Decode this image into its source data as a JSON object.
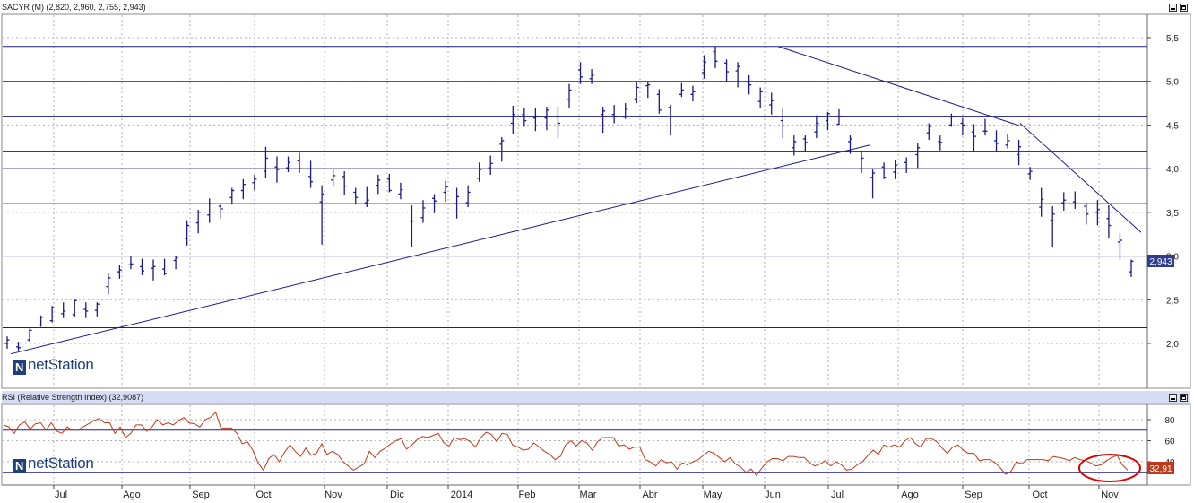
{
  "price_panel": {
    "title": "SACYR (M) (2,820, 2,960, 2,755, 2,943)",
    "last_label": "2,943",
    "logo": "netStation"
  },
  "rsi_panel": {
    "title": "RSI (Relative Strength Index) (32,9087)",
    "last_label": "32,91",
    "logo": "netStation"
  },
  "x_axis_labels": [
    "Jul",
    "Ago",
    "Sep",
    "Oct",
    "Nov",
    "Dic",
    "2014",
    "Feb",
    "Mar",
    "Abr",
    "May",
    "Jun",
    "Jul",
    "Ago",
    "Sep",
    "Oct",
    "Nov"
  ],
  "colors": {
    "price_bar": "#1a1a8c",
    "rsi_line": "#c0391b",
    "trendline": "#1a1a8c",
    "highlight_circle": "#e00000",
    "last_label_bg": "#2e3d8f",
    "rsi_label_bg": "#c0391b"
  },
  "icons": [
    "minimize-icon",
    "maximize-icon",
    "netstation-logo-icon"
  ],
  "chart_data": [
    {
      "type": "bar",
      "subtype": "ohlc",
      "title": "SACYR (M) (2,820, 2,960, 2,755, 2,943)",
      "y_ticks": [
        "2,0",
        "2,5",
        "3,0",
        "3,5",
        "4,0",
        "4,5",
        "5,0",
        "5,5"
      ],
      "ylim": [
        1.6,
        5.7
      ],
      "horizontal_levels": [
        2.18,
        3.0,
        3.6,
        4.0,
        4.2,
        4.6,
        5.0,
        5.4
      ],
      "trendlines": [
        {
          "from": {
            "x": "Jun 2013",
            "y": 1.88
          },
          "to": {
            "x": "Jul 2014",
            "y": 4.27
          }
        },
        {
          "from": {
            "x": "Jun 2014",
            "y": 5.4
          },
          "to": {
            "x": "Sep 2014",
            "y": 4.49
          }
        },
        {
          "from": {
            "x": "Sep 2014",
            "y": 4.52
          },
          "to": {
            "x": "Nov 2014",
            "y": 3.27
          }
        }
      ],
      "series": [
        {
          "values": [
            [
              2.0,
              2.08,
              1.94,
              2.04
            ],
            [
              1.96,
              2.02,
              1.92,
              1.95
            ],
            [
              2.04,
              2.17,
              2.02,
              2.15
            ],
            [
              2.21,
              2.32,
              2.19,
              2.3
            ],
            [
              2.26,
              2.43,
              2.24,
              2.41
            ],
            [
              2.34,
              2.47,
              2.29,
              2.37
            ],
            [
              2.33,
              2.5,
              2.3,
              2.49
            ],
            [
              2.39,
              2.47,
              2.29,
              2.37
            ],
            [
              2.38,
              2.47,
              2.31,
              2.45
            ],
            [
              2.65,
              2.8,
              2.56,
              2.75
            ],
            [
              2.82,
              2.9,
              2.74,
              2.84
            ],
            [
              2.9,
              3.0,
              2.85,
              2.91
            ],
            [
              2.88,
              2.97,
              2.78,
              2.83
            ],
            [
              2.86,
              2.96,
              2.72,
              2.88
            ],
            [
              2.85,
              2.97,
              2.78,
              2.8
            ],
            [
              2.95,
              3.0,
              2.85,
              2.98
            ],
            [
              3.2,
              3.41,
              3.12,
              3.35
            ],
            [
              3.38,
              3.53,
              3.26,
              3.5
            ],
            [
              3.47,
              3.66,
              3.38,
              3.6
            ],
            [
              3.57,
              3.6,
              3.43,
              3.54
            ],
            [
              3.67,
              3.78,
              3.59,
              3.75
            ],
            [
              3.75,
              3.88,
              3.65,
              3.82
            ],
            [
              3.84,
              3.93,
              3.75,
              3.88
            ],
            [
              3.97,
              4.25,
              3.89,
              4.12
            ],
            [
              4.02,
              4.14,
              3.84,
              3.99
            ],
            [
              4.01,
              4.14,
              3.96,
              4.07
            ],
            [
              4.09,
              4.18,
              3.95,
              4.0
            ],
            [
              3.91,
              4.09,
              3.78,
              3.85
            ],
            [
              3.62,
              3.81,
              3.13,
              3.71
            ],
            [
              3.87,
              4.0,
              3.8,
              3.92
            ],
            [
              3.91,
              3.97,
              3.7,
              3.8
            ],
            [
              3.73,
              3.78,
              3.59,
              3.67
            ],
            [
              3.61,
              3.79,
              3.56,
              3.64
            ],
            [
              3.81,
              3.93,
              3.71,
              3.87
            ],
            [
              3.88,
              3.94,
              3.73,
              3.75
            ],
            [
              3.71,
              3.84,
              3.65,
              3.76
            ],
            [
              3.4,
              3.58,
              3.1,
              3.4
            ],
            [
              3.44,
              3.64,
              3.38,
              3.55
            ],
            [
              3.66,
              3.71,
              3.49,
              3.63
            ],
            [
              3.73,
              3.86,
              3.62,
              3.79
            ],
            [
              3.6,
              3.78,
              3.43,
              3.68
            ],
            [
              3.61,
              3.81,
              3.56,
              3.73
            ],
            [
              3.89,
              4.07,
              3.85,
              3.99
            ],
            [
              4.01,
              4.15,
              3.93,
              4.06
            ],
            [
              4.28,
              4.36,
              4.08,
              4.32
            ],
            [
              4.52,
              4.72,
              4.4,
              4.62
            ],
            [
              4.62,
              4.7,
              4.48,
              4.55
            ],
            [
              4.58,
              4.69,
              4.43,
              4.6
            ],
            [
              4.58,
              4.71,
              4.44,
              4.67
            ],
            [
              4.6,
              4.71,
              4.35,
              4.52
            ],
            [
              4.79,
              4.97,
              4.7,
              4.9
            ],
            [
              5.13,
              5.22,
              4.97,
              5.05
            ],
            [
              5.03,
              5.14,
              4.97,
              5.07
            ],
            [
              4.62,
              4.71,
              4.41,
              4.66
            ],
            [
              4.62,
              4.73,
              4.52,
              4.6
            ],
            [
              4.59,
              4.75,
              4.57,
              4.68
            ],
            [
              4.8,
              4.99,
              4.75,
              4.93
            ],
            [
              4.95,
              4.99,
              4.81,
              4.96
            ],
            [
              4.85,
              4.91,
              4.63,
              4.67
            ],
            [
              4.7,
              4.73,
              4.38,
              4.6
            ],
            [
              4.85,
              4.98,
              4.82,
              4.9
            ],
            [
              4.85,
              4.95,
              4.77,
              4.88
            ],
            [
              5.1,
              5.3,
              5.03,
              5.22
            ],
            [
              5.34,
              5.4,
              5.15,
              5.23
            ],
            [
              5.21,
              5.25,
              5.0,
              5.11
            ],
            [
              5.12,
              5.22,
              4.93,
              5.17
            ],
            [
              4.99,
              5.07,
              4.85,
              4.96
            ],
            [
              4.77,
              4.93,
              4.69,
              4.88
            ],
            [
              4.73,
              4.87,
              4.62,
              4.78
            ],
            [
              4.55,
              4.7,
              4.35,
              4.49
            ],
            [
              4.24,
              4.38,
              4.15,
              4.31
            ],
            [
              4.34,
              4.38,
              4.19,
              4.3
            ],
            [
              4.42,
              4.61,
              4.35,
              4.52
            ],
            [
              4.55,
              4.65,
              4.44,
              4.63
            ],
            [
              4.51,
              4.68,
              4.5,
              4.6
            ],
            [
              4.31,
              4.38,
              4.17,
              4.34
            ],
            [
              4.0,
              4.21,
              3.95,
              4.12
            ],
            [
              3.9,
              3.99,
              3.66,
              3.95
            ],
            [
              4.02,
              4.07,
              3.88,
              3.9
            ],
            [
              3.96,
              4.1,
              3.88,
              4.04
            ],
            [
              4.07,
              4.13,
              3.95,
              4.0
            ],
            [
              4.16,
              4.29,
              4.01,
              4.24
            ],
            [
              4.41,
              4.52,
              4.33,
              4.48
            ],
            [
              4.31,
              4.38,
              4.21,
              4.3
            ],
            [
              4.5,
              4.63,
              4.48,
              4.6
            ],
            [
              4.52,
              4.58,
              4.38,
              4.5
            ],
            [
              4.42,
              4.51,
              4.2,
              4.37
            ],
            [
              4.43,
              4.57,
              4.38,
              4.43
            ],
            [
              4.32,
              4.44,
              4.19,
              4.29
            ],
            [
              4.27,
              4.4,
              4.23,
              4.32
            ],
            [
              4.16,
              4.33,
              4.04,
              4.25
            ],
            [
              3.94,
              4.02,
              3.87,
              3.97
            ],
            [
              3.56,
              3.78,
              3.45,
              3.65
            ],
            [
              3.41,
              3.57,
              3.1,
              3.48
            ],
            [
              3.61,
              3.73,
              3.52,
              3.64
            ],
            [
              3.62,
              3.74,
              3.54,
              3.6
            ],
            [
              3.57,
              3.61,
              3.36,
              3.48
            ],
            [
              3.5,
              3.64,
              3.35,
              3.53
            ],
            [
              3.43,
              3.58,
              3.21,
              3.35
            ],
            [
              3.16,
              3.26,
              2.96,
              3.18
            ],
            [
              2.82,
              2.96,
              2.76,
              2.94
            ]
          ]
        }
      ],
      "last_value": 2.943
    },
    {
      "type": "line",
      "title": "RSI (Relative Strength Index) (32,9087)",
      "y_ticks": [
        "40",
        "60",
        "80"
      ],
      "ylim": [
        18,
        92
      ],
      "horizontal_levels": [
        30,
        70
      ],
      "series": [
        {
          "values": [
            75,
            73,
            67,
            75,
            78,
            71,
            76,
            77,
            70,
            77,
            69,
            67,
            73,
            70,
            70,
            73,
            76,
            79,
            81,
            77,
            77,
            67,
            73,
            63,
            67,
            75,
            75,
            69,
            73,
            80,
            75,
            77,
            75,
            79,
            82,
            77,
            76,
            73,
            80,
            82,
            87,
            72,
            72,
            72,
            67,
            57,
            59,
            51,
            39,
            32,
            43,
            47,
            40,
            49,
            56,
            50,
            45,
            53,
            46,
            48,
            57,
            47,
            50,
            47,
            40,
            36,
            32,
            35,
            38,
            50,
            44,
            50,
            53,
            57,
            60,
            62,
            52,
            56,
            61,
            64,
            63,
            65,
            67,
            58,
            55,
            63,
            61,
            62,
            59,
            54,
            63,
            68,
            66,
            59,
            67,
            66,
            56,
            54,
            51,
            52,
            58,
            54,
            50,
            47,
            42,
            45,
            56,
            60,
            55,
            60,
            58,
            51,
            59,
            63,
            63,
            63,
            55,
            56,
            52,
            54,
            54,
            42,
            40,
            36,
            42,
            39,
            40,
            33,
            39,
            37,
            40,
            42,
            46,
            50,
            48,
            44,
            40,
            44,
            38,
            35,
            30,
            33,
            27,
            34,
            40,
            43,
            43,
            41,
            45,
            45,
            44,
            44,
            39,
            36,
            38,
            41,
            36,
            40,
            37,
            32,
            33,
            37,
            40,
            46,
            51,
            47,
            56,
            54,
            56,
            54,
            60,
            63,
            57,
            54,
            62,
            62,
            59,
            53,
            48,
            54,
            56,
            51,
            48,
            48,
            41,
            42,
            42,
            39,
            34,
            28,
            31,
            40,
            38,
            42,
            42,
            42,
            42,
            41,
            45,
            44,
            43,
            41,
            44,
            42,
            41,
            39,
            36,
            37,
            41,
            44,
            46,
            37,
            32
          ]
        }
      ],
      "last_value": 32.91
    }
  ]
}
